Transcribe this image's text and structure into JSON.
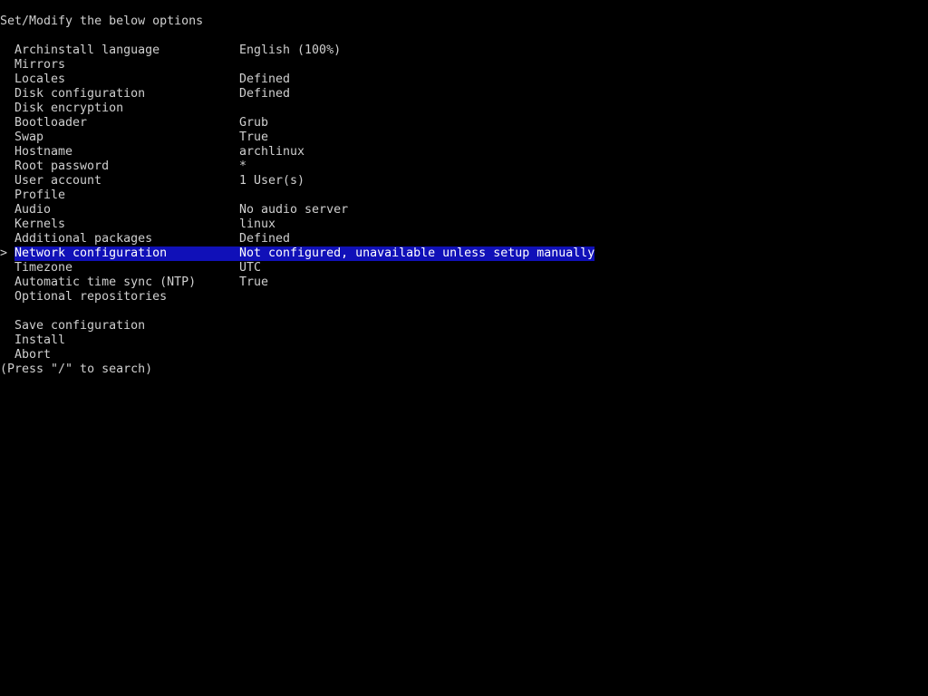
{
  "header": "Set/Modify the below options",
  "selected_index": 14,
  "cursor_symbol": ">",
  "options": [
    {
      "label": "Archinstall language",
      "value": "English (100%)"
    },
    {
      "label": "Mirrors",
      "value": ""
    },
    {
      "label": "Locales",
      "value": "Defined"
    },
    {
      "label": "Disk configuration",
      "value": "Defined"
    },
    {
      "label": "Disk encryption",
      "value": ""
    },
    {
      "label": "Bootloader",
      "value": "Grub"
    },
    {
      "label": "Swap",
      "value": "True"
    },
    {
      "label": "Hostname",
      "value": "archlinux"
    },
    {
      "label": "Root password",
      "value": "*"
    },
    {
      "label": "User account",
      "value": "1 User(s)"
    },
    {
      "label": "Profile",
      "value": ""
    },
    {
      "label": "Audio",
      "value": "No audio server"
    },
    {
      "label": "Kernels",
      "value": "linux"
    },
    {
      "label": "Additional packages",
      "value": "Defined"
    },
    {
      "label": "Network configuration",
      "value": "Not configured, unavailable unless setup manually"
    },
    {
      "label": "Timezone",
      "value": "UTC"
    },
    {
      "label": "Automatic time sync (NTP)",
      "value": "True"
    },
    {
      "label": "Optional repositories",
      "value": ""
    }
  ],
  "actions": [
    {
      "label": "Save configuration"
    },
    {
      "label": "Install"
    },
    {
      "label": "Abort"
    }
  ],
  "footer": "(Press \"/\" to search)",
  "colors": {
    "background": "#000000",
    "text": "#cfcfcf",
    "highlight_bg": "#1010b8",
    "highlight_text": "#ffffff"
  }
}
